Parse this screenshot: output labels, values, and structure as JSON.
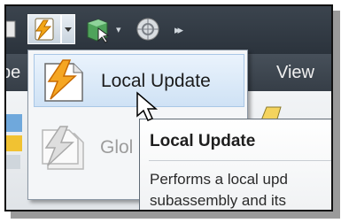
{
  "menu": {
    "items": [
      {
        "label": "Local Update",
        "icon": "lightning-update-icon",
        "state": "highlighted"
      },
      {
        "label": "Glol",
        "icon": "lightning-update-icon",
        "state": "disabled"
      }
    ]
  },
  "ribbon": {
    "tab_view": "View",
    "tab_left_partial": "pe"
  },
  "tooltip": {
    "title": "Local Update",
    "line1": "Performs a local upd",
    "line2": "subassembly and its"
  },
  "colors": {
    "toolbar_dark": "#2d3640",
    "menu_highlight": "#cfe2f5",
    "tooltip_border": "#5f6a75"
  }
}
